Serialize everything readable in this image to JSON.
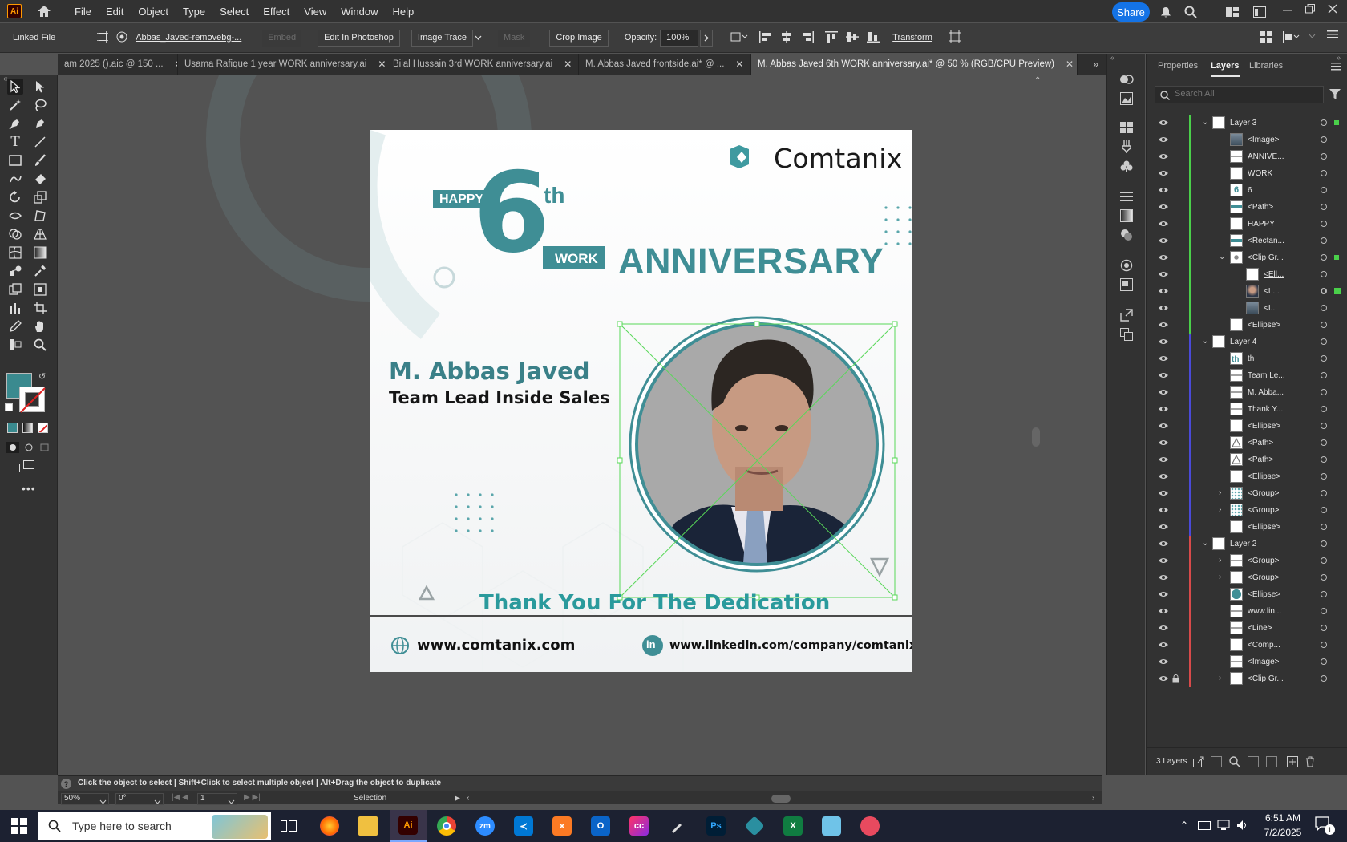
{
  "app": {
    "logo": "Ai",
    "menus": [
      "File",
      "Edit",
      "Object",
      "Type",
      "Select",
      "Effect",
      "View",
      "Window",
      "Help"
    ],
    "share_label": "Share"
  },
  "control": {
    "linked_file": "Linked File",
    "filename": "Abbas_Javed-removebg-...",
    "embed": "Embed",
    "edit_in_photoshop": "Edit In Photoshop",
    "image_trace": "Image Trace",
    "mask": "Mask",
    "crop_image": "Crop Image",
    "opacity_label": "Opacity:",
    "opacity_value": "100%",
    "transform": "Transform"
  },
  "tabs": [
    {
      "label": "am 2025 ().aic @ 150 ..."
    },
    {
      "label": "Usama Rafique 1 year WORK anniversary.ai"
    },
    {
      "label": "Bilal Hussain  3rd  WORK anniversary.ai"
    },
    {
      "label": "M. Abbas Javed   frontside.ai* @ ..."
    },
    {
      "label": "M. Abbas Javed  6th  WORK anniversary.ai* @ 50 % (RGB/CPU Preview)"
    }
  ],
  "artwork": {
    "brand": "Comtanix",
    "happy": "HAPPY",
    "number": "6",
    "ordinal": "th",
    "work": "WORK",
    "anniversary": "ANNIVERSARY",
    "person_name": "M. Abbas Javed",
    "person_title": "Team Lead Inside Sales",
    "thank_you": "Thank You For The Dedication",
    "website": "www.comtanix.com",
    "linkedin_icon": "in",
    "linkedin": "www.linkedin.com/company/comtanix/",
    "colors": {
      "teal": "#3f8e95",
      "dark_teal": "#2f7f86",
      "name": "#3a8088",
      "thank": "#2a9a9c"
    }
  },
  "panel": {
    "tabs": [
      "Properties",
      "Layers",
      "Libraries"
    ],
    "search_placeholder": "Search All",
    "rows": [
      {
        "name": "Layer 3",
        "color": "#4ad04a",
        "level": 0,
        "expand": "down",
        "thumb": "blank"
      },
      {
        "name": "<Image>",
        "color": "#4ad04a",
        "level": 1,
        "thumb": "img"
      },
      {
        "name": "ANNIVE...",
        "color": "#4ad04a",
        "level": 1,
        "thumb": "text"
      },
      {
        "name": "WORK",
        "color": "#4ad04a",
        "level": 1,
        "thumb": "blank"
      },
      {
        "name": "6",
        "color": "#4ad04a",
        "level": 1,
        "thumb": "six"
      },
      {
        "name": "<Path>",
        "color": "#4ad04a",
        "level": 1,
        "thumb": "teal"
      },
      {
        "name": "HAPPY",
        "color": "#4ad04a",
        "level": 1,
        "thumb": "blank"
      },
      {
        "name": "<Rectan...",
        "color": "#4ad04a",
        "level": 1,
        "thumb": "teal"
      },
      {
        "name": "<Clip Gr...",
        "color": "#4ad04a",
        "level": 1,
        "expand": "down",
        "thumb": "dot"
      },
      {
        "name": "<Ell...",
        "color": "#4ad04a",
        "level": 2,
        "thumb": "blank"
      },
      {
        "name": "<L...",
        "color": "#4ad04a",
        "level": 2,
        "thumb": "face"
      },
      {
        "name": "<I...",
        "color": "#4ad04a",
        "level": 2,
        "thumb": "img"
      },
      {
        "name": "<Ellipse>",
        "color": "#4ad04a",
        "level": 1,
        "thumb": "blank"
      },
      {
        "name": "Layer 4",
        "color": "#4a4ad8",
        "level": 0,
        "expand": "down",
        "thumb": "blank"
      },
      {
        "name": "th",
        "color": "#4a4ad8",
        "level": 1,
        "thumb": "th"
      },
      {
        "name": "Team Le...",
        "color": "#4a4ad8",
        "level": 1,
        "thumb": "text"
      },
      {
        "name": "M. Abba...",
        "color": "#4a4ad8",
        "level": 1,
        "thumb": "text"
      },
      {
        "name": "Thank Y...",
        "color": "#4a4ad8",
        "level": 1,
        "thumb": "text"
      },
      {
        "name": "<Ellipse>",
        "color": "#4a4ad8",
        "level": 1,
        "thumb": "blank"
      },
      {
        "name": "<Path>",
        "color": "#4a4ad8",
        "level": 1,
        "thumb": "tri"
      },
      {
        "name": "<Path>",
        "color": "#4a4ad8",
        "level": 1,
        "thumb": "tri"
      },
      {
        "name": "<Ellipse>",
        "color": "#4a4ad8",
        "level": 1,
        "thumb": "blank"
      },
      {
        "name": "<Group>",
        "color": "#4a4ad8",
        "level": 1,
        "expand": "right",
        "thumb": "dots"
      },
      {
        "name": "<Group>",
        "color": "#4a4ad8",
        "level": 1,
        "expand": "right",
        "thumb": "dots"
      },
      {
        "name": "<Ellipse>",
        "color": "#4a4ad8",
        "level": 1,
        "thumb": "blank"
      },
      {
        "name": "Layer 2",
        "color": "#d84a4a",
        "level": 0,
        "expand": "down",
        "thumb": "blank"
      },
      {
        "name": "<Group>",
        "color": "#d84a4a",
        "level": 1,
        "expand": "right",
        "thumb": "text"
      },
      {
        "name": "<Group>",
        "color": "#d84a4a",
        "level": 1,
        "expand": "right",
        "thumb": "blank"
      },
      {
        "name": "<Ellipse>",
        "color": "#d84a4a",
        "level": 1,
        "thumb": "tealcircle"
      },
      {
        "name": "www.lin...",
        "color": "#d84a4a",
        "level": 1,
        "thumb": "text"
      },
      {
        "name": "<Line>",
        "color": "#d84a4a",
        "level": 1,
        "thumb": "text"
      },
      {
        "name": "<Comp...",
        "color": "#d84a4a",
        "level": 1,
        "thumb": "blank"
      },
      {
        "name": "<Image>",
        "color": "#d84a4a",
        "level": 1,
        "thumb": "text"
      },
      {
        "name": "<Clip Gr...",
        "color": "#d84a4a",
        "level": 1,
        "expand": "right",
        "thumb": "blank",
        "locked": true
      }
    ],
    "layers_count": "3 Layers"
  },
  "status": {
    "hint": "Click the object to select  |  Shift+Click to select multiple object  |  Alt+Drag the object to duplicate",
    "zoom": "50%",
    "rotation": "0°",
    "artboard_num": "1",
    "tool": "Selection"
  },
  "taskbar": {
    "search_placeholder": "Type here to search",
    "time": "6:51 AM",
    "date": "7/2/2025",
    "notif_count": "1"
  }
}
